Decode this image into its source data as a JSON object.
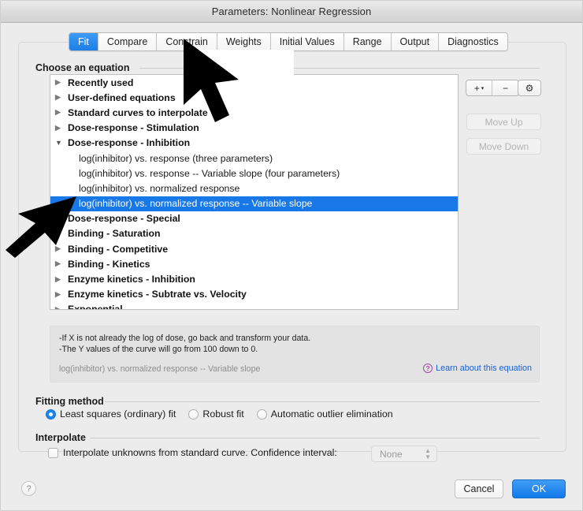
{
  "window": {
    "title": "Parameters: Nonlinear Regression"
  },
  "tabs": [
    {
      "label": "Fit",
      "active": true
    },
    {
      "label": "Compare",
      "active": false
    },
    {
      "label": "Constrain",
      "active": false
    },
    {
      "label": "Weights",
      "active": false
    },
    {
      "label": "Initial Values",
      "active": false
    },
    {
      "label": "Range",
      "active": false
    },
    {
      "label": "Output",
      "active": false
    },
    {
      "label": "Diagnostics",
      "active": false
    }
  ],
  "equation_section": {
    "label": "Choose an equation",
    "rows": [
      {
        "type": "group",
        "label": "Recently used",
        "expanded": false,
        "selected": false
      },
      {
        "type": "group",
        "label": "User-defined equations",
        "expanded": false,
        "selected": false
      },
      {
        "type": "group",
        "label": "Standard curves to interpolate",
        "expanded": false,
        "selected": false
      },
      {
        "type": "group",
        "label": "Dose-response - Stimulation",
        "expanded": false,
        "selected": false
      },
      {
        "type": "group",
        "label": "Dose-response - Inhibition",
        "expanded": true,
        "selected": false
      },
      {
        "type": "leaf",
        "label": "log(inhibitor) vs. response (three parameters)",
        "selected": false
      },
      {
        "type": "leaf",
        "label": "log(inhibitor) vs. response -- Variable slope (four parameters)",
        "selected": false
      },
      {
        "type": "leaf",
        "label": "log(inhibitor) vs. normalized response",
        "selected": false
      },
      {
        "type": "leaf",
        "label": "log(inhibitor) vs. normalized response -- Variable slope",
        "selected": true
      },
      {
        "type": "group",
        "label": "Dose-response - Special",
        "expanded": false,
        "selected": false
      },
      {
        "type": "group",
        "label": "Binding - Saturation",
        "expanded": false,
        "selected": false
      },
      {
        "type": "group",
        "label": "Binding - Competitive",
        "expanded": false,
        "selected": false
      },
      {
        "type": "group",
        "label": "Binding - Kinetics",
        "expanded": false,
        "selected": false
      },
      {
        "type": "group",
        "label": "Enzyme kinetics - Inhibition",
        "expanded": false,
        "selected": false
      },
      {
        "type": "group",
        "label": "Enzyme kinetics - Subtrate vs. Velocity",
        "expanded": false,
        "selected": false
      },
      {
        "type": "group",
        "label": "Exponential",
        "expanded": false,
        "selected": false
      }
    ],
    "list_controls": {
      "add_label": "+",
      "add_caret": "▾",
      "remove_label": "−",
      "gear_label": "⚙",
      "move_up_label": "Move Up",
      "move_down_label": "Move Down"
    }
  },
  "description": {
    "line1": "-If X is not already the log of dose, go back and transform your data.",
    "line2": "-The Y values of the curve will go from 100 down to 0.",
    "equation_name": "log(inhibitor) vs. normalized response -- Variable slope",
    "learn_link": "Learn about this equation",
    "learn_icon_glyph": "?"
  },
  "fitting_method": {
    "label": "Fitting method",
    "options": [
      {
        "label": "Least squares (ordinary) fit",
        "selected": true
      },
      {
        "label": "Robust fit",
        "selected": false
      },
      {
        "label": "Automatic outlier elimination",
        "selected": false
      }
    ]
  },
  "interpolate": {
    "label": "Interpolate",
    "checkbox_label": "Interpolate unknowns from standard curve. Confidence interval:",
    "checked": false,
    "confidence_interval_value": "None"
  },
  "footer": {
    "help_label": "?",
    "cancel_label": "Cancel",
    "ok_label": "OK"
  },
  "colors": {
    "accent_blue": "#1878e8",
    "selection_blue": "#1878e8",
    "link_blue": "#1a5fd0",
    "window_bg": "#ececec",
    "help_purple": "#a04ba0"
  }
}
